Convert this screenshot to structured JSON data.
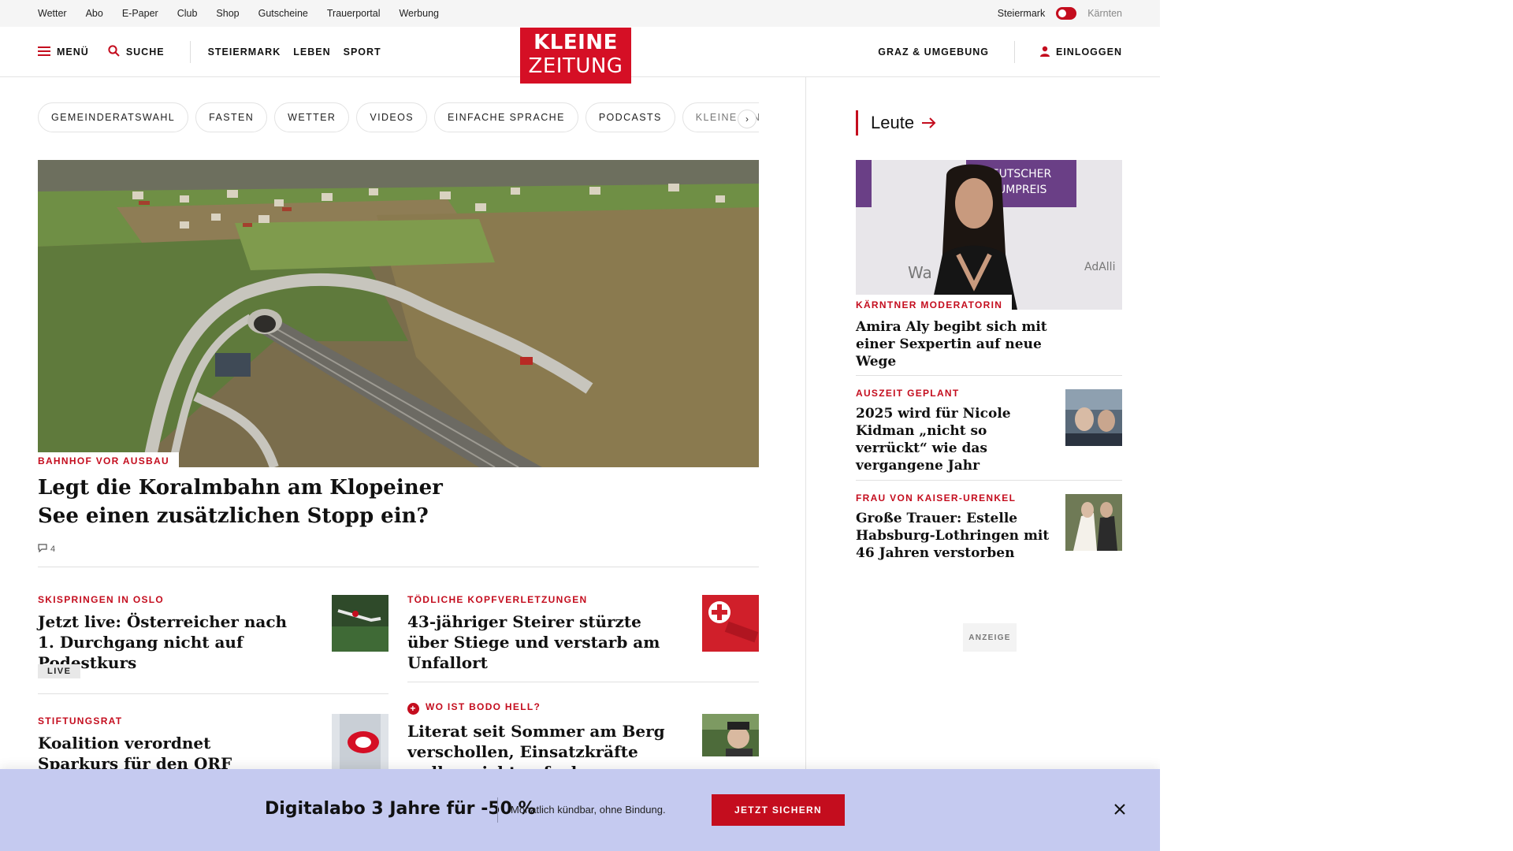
{
  "utility": {
    "links": [
      "Wetter",
      "Abo",
      "E-Paper",
      "Club",
      "Shop",
      "Gutscheine",
      "Trauerportal",
      "Werbung"
    ],
    "region_active": "Steiermark",
    "region_inactive": "Kärnten"
  },
  "header": {
    "menu_label": "MENÜ",
    "search_label": "SUCHE",
    "nav": [
      "STEIERMARK",
      "LEBEN",
      "SPORT"
    ],
    "logo_line1": "KLEINE",
    "logo_line2": "ZEITUNG",
    "local_label": "GRAZ & UMGEBUNG",
    "login_label": "EINLOGGEN"
  },
  "topics": [
    "GEMEINDERATSWAHL",
    "FASTEN",
    "WETTER",
    "VIDEOS",
    "EINFACHE SPRACHE",
    "PODCASTS",
    "KLEINE KINDE"
  ],
  "hero": {
    "kicker": "BAHNHOF VOR AUSBAU",
    "title": "Legt die Koralmbahn am Klopeiner See einen zusätzlichen Stopp ein?",
    "comments": "4"
  },
  "teasers": [
    {
      "kicker": "SKISPRINGEN IN OSLO",
      "title": "Jetzt live: Österreicher nach 1. Durchgang nicht auf Podestkurs",
      "badge": "LIVE"
    },
    {
      "kicker": "TÖDLICHE KOPFVERLETZUNGEN",
      "title": "43-jähriger Steirer stürzte über Stiege und verstarb am Unfallort"
    },
    {
      "kicker": "STIFTUNGSRAT",
      "title": "Koalition verordnet Sparkurs für den ORF"
    },
    {
      "kicker": "WO IST BODO HELL?",
      "title": "Literat seit Sommer am Berg verschollen, Einsatzkräfte wollen nicht aufgeben",
      "plus_icon": "plus-icon"
    }
  ],
  "sidebar": {
    "heading": "Leute",
    "items": [
      {
        "kicker": "KÄRNTNER MODERATORIN",
        "title": "Amira Aly begibt sich mit einer Sexpertin auf neue Wege",
        "image_text1": "DEUTSCHER",
        "image_text2": "FUMPREIS",
        "image_text3": "AdAlli",
        "image_text4": "Wa"
      },
      {
        "kicker": "AUSZEIT GEPLANT",
        "title": "2025 wird für Nicole Kidman „nicht so verrückt“ wie das vergangene Jahr"
      },
      {
        "kicker": "FRAU VON KAISER-URENKEL",
        "title": "Große Trauer: Estelle Habsburg-Lothringen mit 46 Jahren verstorben"
      }
    ],
    "ad_label": "ANZEIGE"
  },
  "banner": {
    "title": "Digitalabo 3 Jahre für -50 %",
    "subtitle": "Monatlich kündbar, ohne Bindung.",
    "cta": "JETZT SICHERN"
  },
  "colors": {
    "brand_red": "#c40d1e",
    "banner_bg": "#c5caf0"
  }
}
